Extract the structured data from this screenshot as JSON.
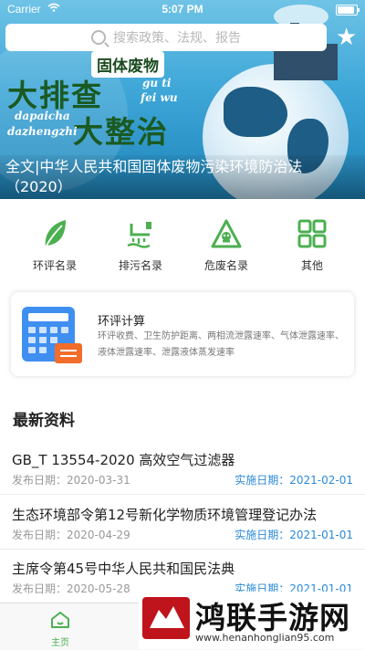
{
  "status_bar": {
    "carrier": "Carrier",
    "time": "5:07 PM"
  },
  "search": {
    "placeholder": "搜索政策、法规、报告"
  },
  "banner": {
    "poster_text": {
      "guti": "固体废物",
      "dapai": "大排查",
      "guti_pinyin": "gu ti",
      "feiwu_pinyin": "fei wu",
      "dazheng": "大整治",
      "dapaicha_pinyin": "dapaicha",
      "dazhengzhi_pinyin": "dazhengzhi"
    },
    "caption": "全文|中华人民共和国固体废物污染环境防治法（2020）"
  },
  "categories": [
    {
      "label": "环评名录",
      "icon": "leaf-icon",
      "color": "#4caf50"
    },
    {
      "label": "排污名录",
      "icon": "discharge-icon",
      "color": "#4caf50"
    },
    {
      "label": "危废名录",
      "icon": "hazard-icon",
      "color": "#4caf50"
    },
    {
      "label": "其他",
      "icon": "grid-icon",
      "color": "#4caf50"
    }
  ],
  "calc_card": {
    "title": "环评计算",
    "desc": "环评收费、卫生防护距离、两相流泄露速率、气体泄露速率、液体泄露速率、泄露液体蒸发速率"
  },
  "latest": {
    "title": "最新资料",
    "items": [
      {
        "title": "GB_T 13554-2020 高效空气过滤器",
        "pub": "发布日期：2020-03-31",
        "eff": "实施日期：2021-02-01"
      },
      {
        "title": "生态环境部令第12号新化学物质环境管理登记办法",
        "pub": "发布日期：2020-04-29",
        "eff": "实施日期：2021-01-01"
      },
      {
        "title": "主席令第45号中华人民共和国民法典",
        "pub": "发布日期：2020-05-28",
        "eff": "实施日期：2021-01-01"
      }
    ]
  },
  "tabbar": {
    "home_label": "主页"
  },
  "watermark": {
    "text": "鸿联手游网",
    "url": "www.henanhonglian95.com"
  },
  "colors": {
    "accent": "#4caf50",
    "link": "#2b8ad9",
    "badge": "#f26d2b",
    "calc": "#3f8ff0"
  }
}
